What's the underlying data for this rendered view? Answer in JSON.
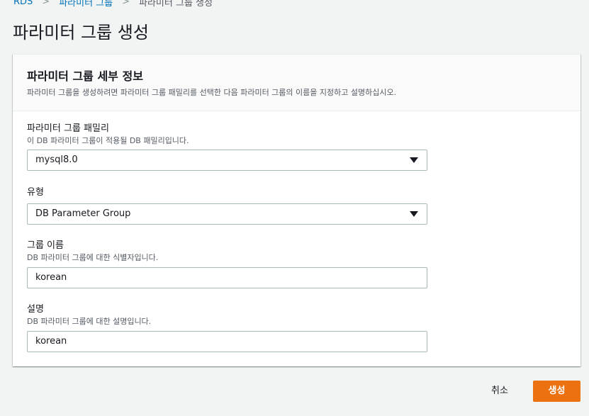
{
  "breadcrumb": {
    "items": [
      "RDS",
      "파라미터 그룹",
      "파라미터 그룹 생성"
    ],
    "separator": ">"
  },
  "page": {
    "title": "파라미터 그룹 생성"
  },
  "panel": {
    "title": "파라미터 그룹 세부 정보",
    "description": "파라미터 그룹을 생성하려면 파라미터 그룹 패밀리를 선택한 다음 파라미터 그룹의 이름을 지정하고 설명하십시오."
  },
  "fields": {
    "family": {
      "label": "파라미터 그룹 패밀리",
      "description": "이 DB 파라미터 그룹이 적용될 DB 패밀리입니다.",
      "value": "mysql8.0"
    },
    "type": {
      "label": "유형",
      "value": "DB Parameter Group"
    },
    "name": {
      "label": "그룹 이름",
      "description": "DB 파라미터 그룹에 대한 식별자입니다.",
      "value": "korean"
    },
    "description": {
      "label": "설명",
      "description": "DB 파라미터 그룹에 대한 설명입니다.",
      "value": "korean"
    }
  },
  "actions": {
    "cancel_label": "취소",
    "create_label": "생성"
  },
  "colors": {
    "link": "#0073bb",
    "primary_button": "#ec7211",
    "background": "#f2f3f3"
  }
}
